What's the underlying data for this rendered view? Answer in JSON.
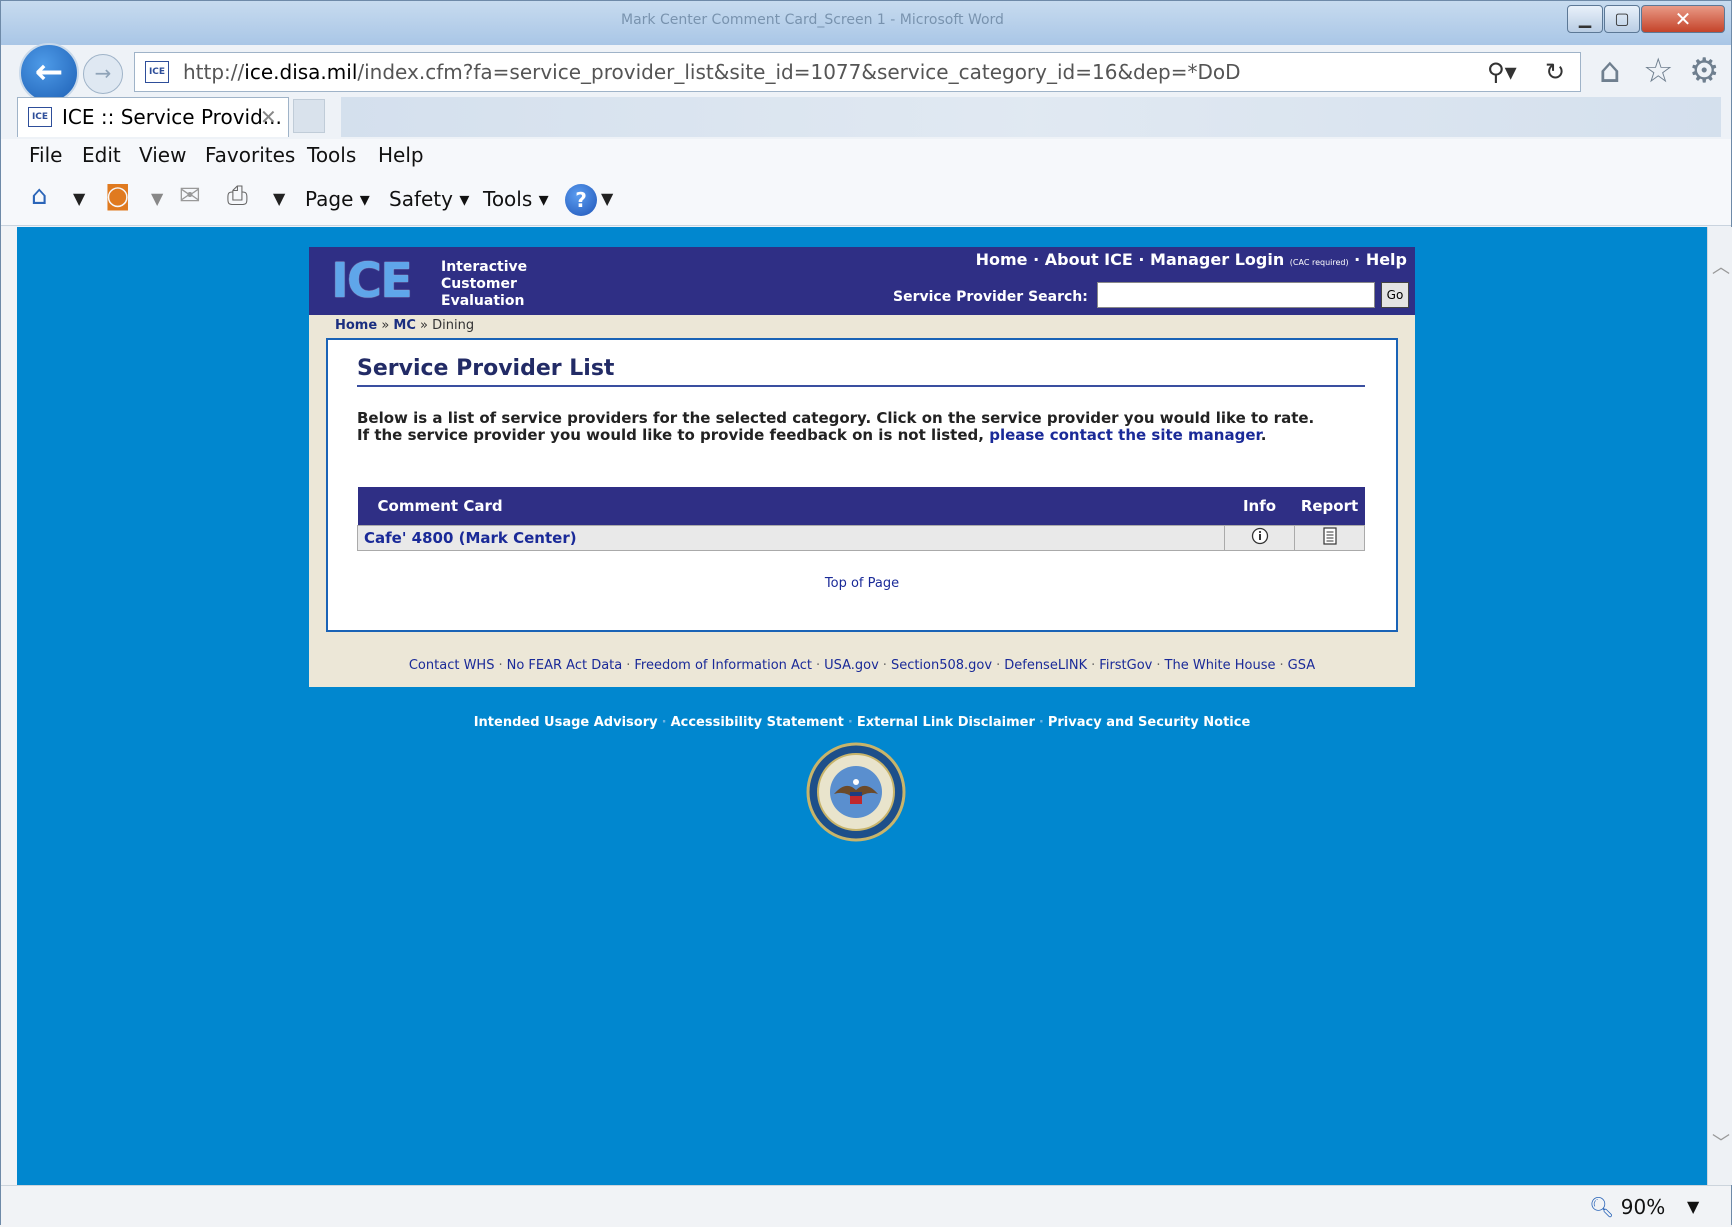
{
  "window": {
    "title": "Mark Center Comment Card_Screen 1 - Microsoft Word"
  },
  "browser": {
    "url_prefix": "http://",
    "url_domain": "ice.disa.mil",
    "url_path": "/index.cfm?fa=service_provider_list&site_id=1077&service_category_id=16&dep=*DoD",
    "favicon_text": "ICE",
    "tab_label": "ICE :: Service Provid...",
    "tab_close": "✕",
    "menu": [
      "File",
      "Edit",
      "View",
      "Favorites",
      "Tools",
      "Help"
    ],
    "commands": [
      "Page",
      "Safety",
      "Tools"
    ],
    "zoom": "90%"
  },
  "ice": {
    "logo": "ICE",
    "logo_words": [
      "Interactive",
      "Customer",
      "Evaluation"
    ],
    "nav": {
      "home": "Home",
      "about": "About ICE",
      "manager_login": "Manager Login",
      "cac_note": "(CAC required)",
      "help": "Help"
    },
    "search_label": "Service Provider Search:",
    "go_label": "Go",
    "breadcrumb": {
      "home": "Home",
      "mc": "MC",
      "current": "Dining"
    },
    "page_title": "Service Provider List",
    "intro_line1": "Below is a list of service providers for the selected category. Click on the service provider you would like to rate.",
    "intro_line2": "If the service provider you would like to provide feedback on is not listed,",
    "intro_link": "please contact the site manager",
    "table": {
      "headers": [
        "Comment Card",
        "Info",
        "Report"
      ],
      "rows": [
        {
          "name": "Cafe' 4800 (Mark Center)"
        }
      ]
    },
    "top_of_page": "Top of Page",
    "footer_links": [
      "Contact WHS",
      "No FEAR Act Data",
      "Freedom of Information Act",
      "USA.gov",
      "Section508.gov",
      "DefenseLINK",
      "FirstGov",
      "The White House",
      "GSA"
    ],
    "bottom_links": [
      "Intended Usage Advisory",
      "Accessibility Statement",
      "External Link Disclaimer",
      "Privacy and Security Notice"
    ]
  },
  "colors": {
    "page_bg": "#0187cf",
    "header_bg": "#2f2f85",
    "link": "#1a2a98"
  }
}
